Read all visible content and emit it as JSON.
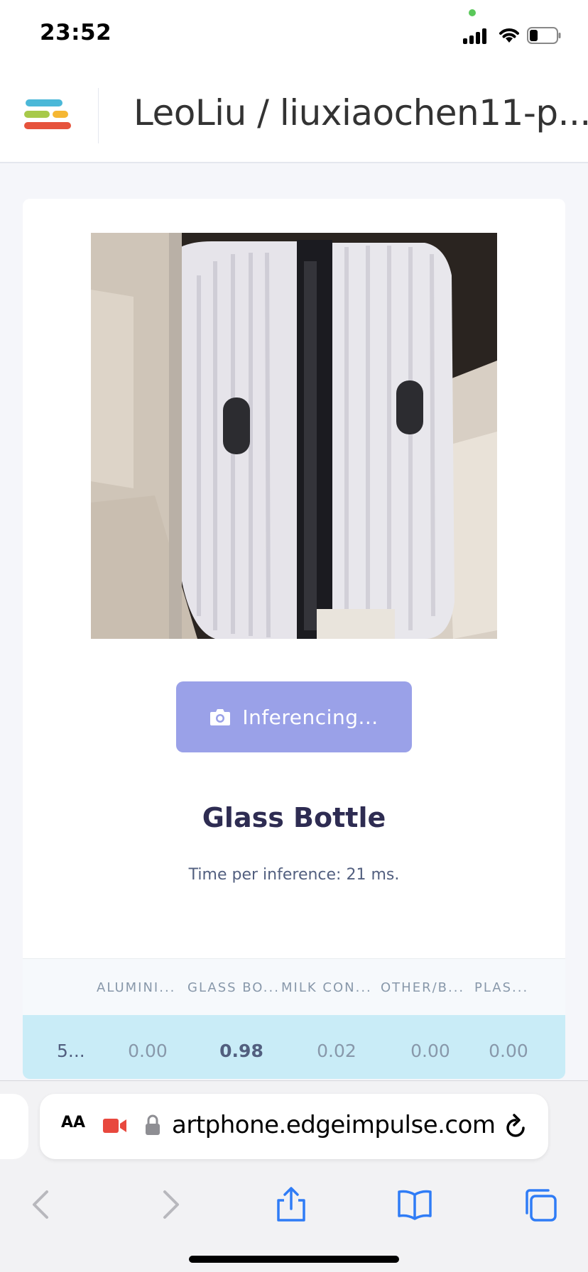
{
  "status_bar": {
    "time": "23:52"
  },
  "header": {
    "project_title": "LeoLiu / liuxiaochen11-p..."
  },
  "inference": {
    "button_label": "Inferencing...",
    "result_label": "Glass Bottle",
    "timing_text": "Time per inference: 21 ms."
  },
  "results_table": {
    "columns": [
      "ALUMINI...",
      "GLASS BO...",
      "MILK CON...",
      "OTHER/B...",
      "PLAS..."
    ],
    "row": {
      "label": "5...",
      "values": [
        "0.00",
        "0.98",
        "0.02",
        "0.00",
        "0.00"
      ]
    }
  },
  "browser": {
    "text_size": "AA",
    "url": "artphone.edgeimpulse.com"
  },
  "colors": {
    "accent": "#9aa1e8",
    "row_highlight": "#c9ecf7",
    "result_text": "#2e2c52"
  }
}
